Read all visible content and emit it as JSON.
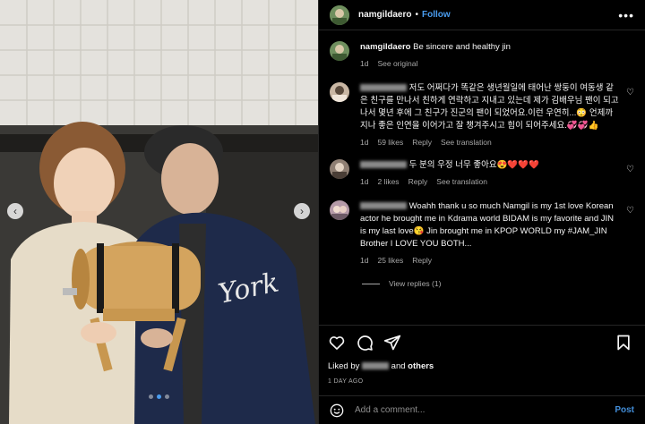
{
  "post": {
    "username": "namgildaero",
    "separator": "•",
    "follow_label": "Follow",
    "more_label": "•••",
    "caption": {
      "username": "namgildaero",
      "text": "Be sincere and healthy jin",
      "time": "1d",
      "see_original": "See original"
    },
    "carousel": {
      "slides": 3,
      "active_index": 1
    }
  },
  "comments": [
    {
      "user_hidden": true,
      "text": "저도 어쩌다가 똑같은 생년월일에 태어난 쌍둥이 여동생 같은 친구를 만나서 친하게 연락하고 지내고 있는데 제가 김배우님 팬이 되고나서 몇년 후에 그 친구가 진군의 팬이 되었어요.이런 우연히...😳 언제까지나 좋은 인연을 이어가고 잘 챙겨주시고 힘이 되어주세요.💞💞👍",
      "time": "1d",
      "likes": "59 likes",
      "reply": "Reply",
      "translate": "See translation",
      "avatar_color": "#c9b7a4"
    },
    {
      "user_hidden": true,
      "text": "두 분의 우정 너무 좋아요😍❤️❤️❤️",
      "time": "1d",
      "likes": "2 likes",
      "reply": "Reply",
      "translate": "See translation",
      "avatar_color": "#8f7f73"
    },
    {
      "user_hidden": true,
      "text": "Woahh thank u so much Namgil is my 1st love Korean actor he brought me in Kdrama world BIDAM is my favorite and JIN is my last love😘 Jin brought me in KPOP WORLD my #JAM_JIN Brother I LOVE YOU BOTH...",
      "time": "1d",
      "likes": "25 likes",
      "reply": "Reply",
      "view_replies": "View replies (1)",
      "avatar_color": "#b59aa8"
    }
  ],
  "actions": {
    "liked_by_prefix": "Liked by",
    "liked_by_suffix": "and",
    "others": "others",
    "time": "1 DAY AGO"
  },
  "add_comment": {
    "placeholder": "Add a comment...",
    "post_label": "Post"
  },
  "colors": {
    "accent": "#4a9df0",
    "background": "#000000",
    "muted": "#a8a8a8"
  },
  "icons": [
    "heart-icon",
    "comment-icon",
    "share-icon",
    "bookmark-icon",
    "emoji-icon",
    "chevron-left-icon",
    "chevron-right-icon"
  ]
}
